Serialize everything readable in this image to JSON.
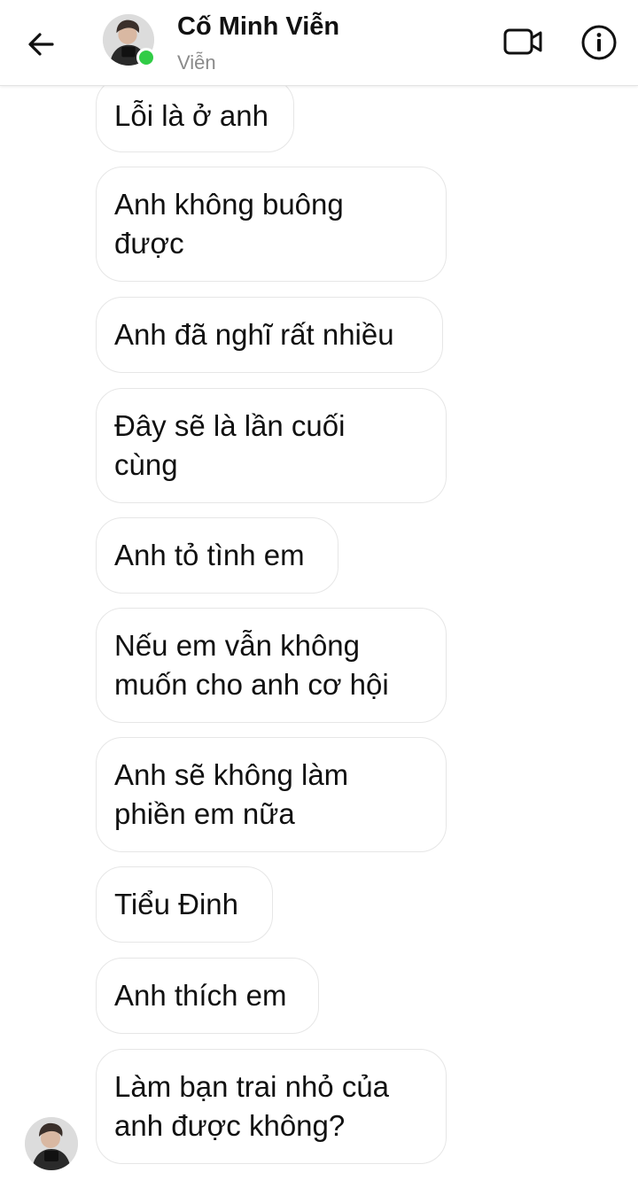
{
  "header": {
    "back_icon": "arrow-left-icon",
    "contact_name": "Cố Minh Viễn",
    "contact_nickname": "Viễn",
    "online_status_color": "#31cc46",
    "video_icon": "video-camera-icon",
    "info_icon": "info-circle-icon"
  },
  "messages": [
    {
      "text": "Lỗi là ở anh"
    },
    {
      "text": "Anh không buông được"
    },
    {
      "text": "Anh đã nghĩ rất nhiều"
    },
    {
      "text": "Đây sẽ là lần cuối cùng"
    },
    {
      "text": "Anh tỏ tình em"
    },
    {
      "text": "Nếu em vẫn không muốn cho anh cơ hội"
    },
    {
      "text": "Anh sẽ không làm phiền em nữa"
    },
    {
      "text": "Tiểu Đinh"
    },
    {
      "text": "Anh thích em"
    },
    {
      "text": "Làm bạn trai nhỏ của anh được không?"
    }
  ],
  "colors": {
    "bubble_border": "#e6e6e6",
    "text": "#111111",
    "subtitle": "#8a8a8a"
  }
}
